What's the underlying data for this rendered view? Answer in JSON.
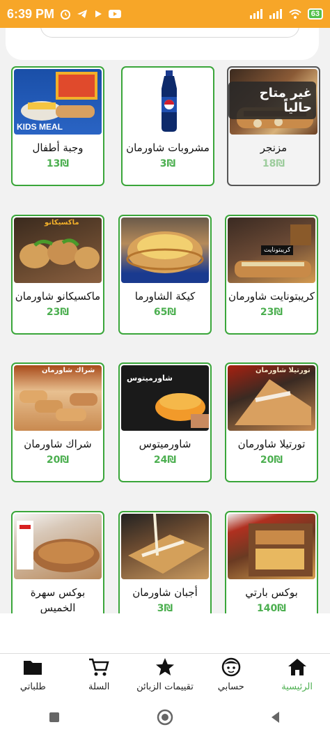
{
  "status_bar": {
    "time": "6:39 PM",
    "battery": "63"
  },
  "products": [
    {
      "name": "مزنجر",
      "price": "18₪",
      "available": false,
      "badge": "غير متاح حالياً"
    },
    {
      "name": "مشروبات شاورمان",
      "price": "3₪",
      "available": true
    },
    {
      "name": "وجبة أطفال",
      "price": "13₪",
      "available": true,
      "img_text": "KIDS MEAL"
    },
    {
      "name": "كريبتونايت شاورمان",
      "price": "23₪",
      "available": true,
      "img_text": "كريبتونايت"
    },
    {
      "name": "كيكة الشاورما",
      "price": "65₪",
      "available": true
    },
    {
      "name": "ماكسيكانو شاورمان",
      "price": "23₪",
      "available": true,
      "img_text": "ماكسيكانو"
    },
    {
      "name": "تورتيلا شاورمان",
      "price": "20₪",
      "available": true,
      "img_text": "تورتيلا شاورمان"
    },
    {
      "name": "شاورميتوس",
      "price": "24₪",
      "available": true,
      "img_text": "شاورميتوس"
    },
    {
      "name": "شراك شاورمان",
      "price": "20₪",
      "available": true,
      "img_text": "شراك شاورمان"
    },
    {
      "name": "بوكس بارتي",
      "price": "140₪",
      "available": true
    },
    {
      "name": "أجبان شاورمان",
      "price": "3₪",
      "available": true
    },
    {
      "name": "بوكس سهرة الخميس",
      "price": "",
      "available": true
    }
  ],
  "bottom_nav": [
    {
      "label": "الرئيسية",
      "icon": "home-icon",
      "active": true
    },
    {
      "label": "حسابي",
      "icon": "face-icon",
      "active": false
    },
    {
      "label": "تقييمات الزبائن",
      "icon": "star-icon",
      "active": false
    },
    {
      "label": "السلة",
      "icon": "cart-icon",
      "active": false
    },
    {
      "label": "طلباتي",
      "icon": "folder-icon",
      "active": false
    }
  ],
  "colors": {
    "status_bar": "#f7a628",
    "accent_green": "#4caf50",
    "card_border": "#3aa63a"
  }
}
